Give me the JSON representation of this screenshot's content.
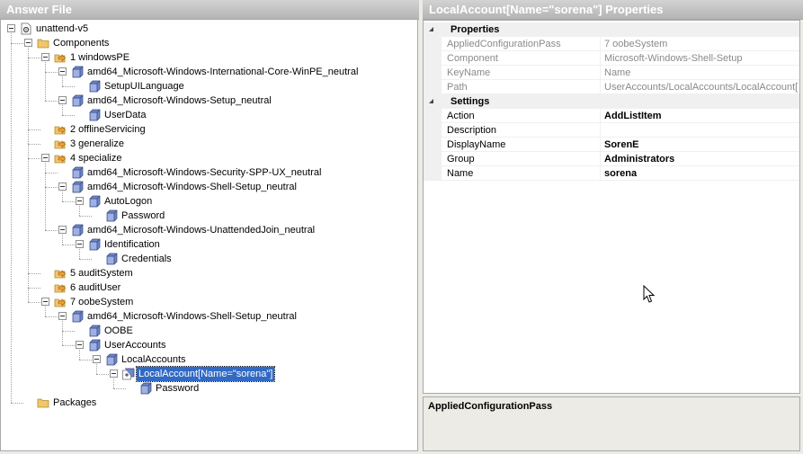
{
  "left_pane": {
    "title": "Answer File"
  },
  "right_pane": {
    "title": "LocalAccount[Name=\"sorena\"] Properties"
  },
  "tree": [
    {
      "label": "unattend-v5",
      "depth": 0,
      "icon": "file-gear-icon",
      "expanded": true
    },
    {
      "label": "Components",
      "depth": 1,
      "icon": "folder-icon",
      "expanded": true
    },
    {
      "label": "1 windowsPE",
      "depth": 2,
      "icon": "pass-arrow-icon",
      "expanded": true
    },
    {
      "label": "amd64_Microsoft-Windows-International-Core-WinPE_neutral",
      "depth": 3,
      "icon": "component-cube-icon",
      "expanded": true
    },
    {
      "label": "SetupUILanguage",
      "depth": 4,
      "icon": "setting-cube-icon",
      "expanded": null
    },
    {
      "label": "amd64_Microsoft-Windows-Setup_neutral",
      "depth": 3,
      "icon": "component-cube-icon",
      "expanded": true
    },
    {
      "label": "UserData",
      "depth": 4,
      "icon": "setting-cube-icon",
      "expanded": null
    },
    {
      "label": "2 offlineServicing",
      "depth": 2,
      "icon": "pass-arrow-icon",
      "expanded": null
    },
    {
      "label": "3 generalize",
      "depth": 2,
      "icon": "pass-arrow-icon",
      "expanded": null
    },
    {
      "label": "4 specialize",
      "depth": 2,
      "icon": "pass-arrow-icon",
      "expanded": true
    },
    {
      "label": "amd64_Microsoft-Windows-Security-SPP-UX_neutral",
      "depth": 3,
      "icon": "component-cube-icon",
      "expanded": null
    },
    {
      "label": "amd64_Microsoft-Windows-Shell-Setup_neutral",
      "depth": 3,
      "icon": "component-cube-icon",
      "expanded": true
    },
    {
      "label": "AutoLogon",
      "depth": 4,
      "icon": "setting-cube-icon",
      "expanded": true
    },
    {
      "label": "Password",
      "depth": 5,
      "icon": "setting-cube-icon",
      "expanded": null
    },
    {
      "label": "amd64_Microsoft-Windows-UnattendedJoin_neutral",
      "depth": 3,
      "icon": "component-cube-icon",
      "expanded": true
    },
    {
      "label": "Identification",
      "depth": 4,
      "icon": "setting-cube-icon",
      "expanded": true
    },
    {
      "label": "Credentials",
      "depth": 5,
      "icon": "setting-cube-icon",
      "expanded": null
    },
    {
      "label": "5 auditSystem",
      "depth": 2,
      "icon": "pass-arrow-icon",
      "expanded": null
    },
    {
      "label": "6 auditUser",
      "depth": 2,
      "icon": "pass-arrow-icon",
      "expanded": null
    },
    {
      "label": "7 oobeSystem",
      "depth": 2,
      "icon": "pass-arrow-icon",
      "expanded": true
    },
    {
      "label": "amd64_Microsoft-Windows-Shell-Setup_neutral",
      "depth": 3,
      "icon": "component-cube-icon",
      "expanded": true
    },
    {
      "label": "OOBE",
      "depth": 4,
      "icon": "setting-cube-icon",
      "expanded": null
    },
    {
      "label": "UserAccounts",
      "depth": 4,
      "icon": "setting-cube-icon",
      "expanded": true
    },
    {
      "label": "LocalAccounts",
      "depth": 5,
      "icon": "setting-cube-icon",
      "expanded": true
    },
    {
      "label": "LocalAccount[Name=\"sorena\"]",
      "depth": 6,
      "icon": "list-item-cube-icon",
      "expanded": true,
      "selected": true
    },
    {
      "label": "Password",
      "depth": 7,
      "icon": "setting-cube-icon",
      "expanded": null
    },
    {
      "label": "Packages",
      "depth": 1,
      "icon": "folder-icon",
      "expanded": null
    }
  ],
  "properties": {
    "categories": [
      {
        "name": "Properties",
        "rows": [
          {
            "name": "AppliedConfigurationPass",
            "value": "7 oobeSystem",
            "readonly": true
          },
          {
            "name": "Component",
            "value": "Microsoft-Windows-Shell-Setup",
            "readonly": true
          },
          {
            "name": "KeyName",
            "value": "Name",
            "readonly": true
          },
          {
            "name": "Path",
            "value": "UserAccounts/LocalAccounts/LocalAccount[",
            "readonly": true
          }
        ]
      },
      {
        "name": "Settings",
        "rows": [
          {
            "name": "Action",
            "value": "AddListItem",
            "readonly": false
          },
          {
            "name": "Description",
            "value": "",
            "readonly": false
          },
          {
            "name": "DisplayName",
            "value": "SorenE",
            "readonly": false
          },
          {
            "name": "Group",
            "value": "Administrators",
            "readonly": false
          },
          {
            "name": "Name",
            "value": "sorena",
            "readonly": false
          }
        ]
      }
    ]
  },
  "description_panel": {
    "title": "AppliedConfigurationPass"
  },
  "colors": {
    "selection": "#316ac5",
    "folder": "#f2c76b",
    "cube": "#6f86c8",
    "header_gradient_top": "#d3d3d3"
  }
}
